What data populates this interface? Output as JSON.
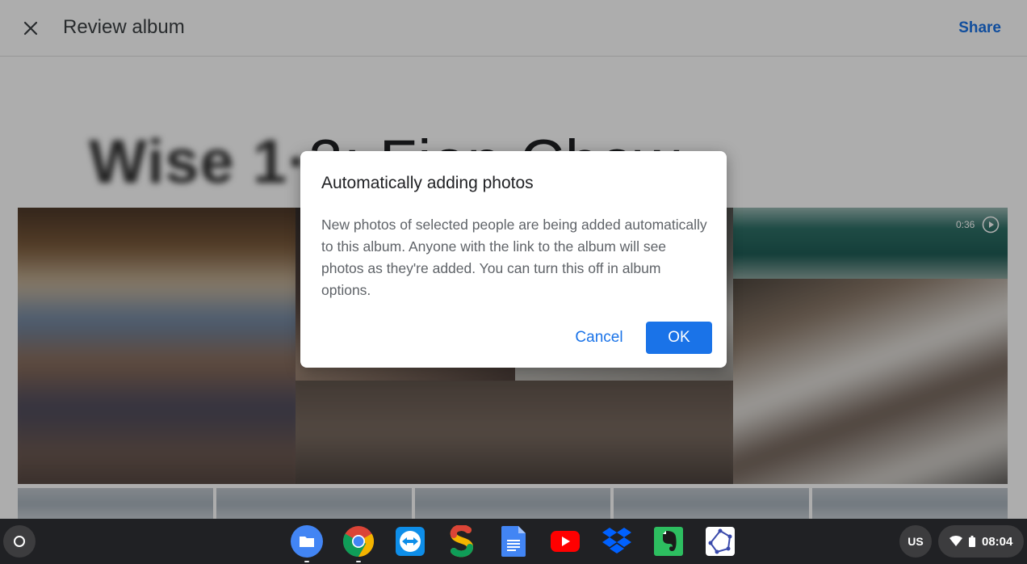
{
  "header": {
    "title": "Review album",
    "share_label": "Share"
  },
  "album": {
    "title_blurred": "Wise 1·",
    "title_clear": "3: Fion Chow",
    "video_duration": "0:36"
  },
  "dialog": {
    "title": "Automatically adding photos",
    "body": "New photos of selected people are being added automatically to this album. Anyone with the link to the album will see photos as they're added. You can turn this off in album options.",
    "cancel_label": "Cancel",
    "ok_label": "OK"
  },
  "shelf": {
    "apps": [
      {
        "name": "files-app-icon"
      },
      {
        "name": "chrome-app-icon"
      },
      {
        "name": "teamviewer-app-icon"
      },
      {
        "name": "sketchbook-app-icon"
      },
      {
        "name": "google-docs-app-icon"
      },
      {
        "name": "youtube-app-icon"
      },
      {
        "name": "dropbox-app-icon"
      },
      {
        "name": "evernote-app-icon"
      },
      {
        "name": "polygon-app-icon"
      }
    ],
    "ime_label": "US",
    "clock": "08:04"
  },
  "colors": {
    "accent": "#1a73e8",
    "shelf_bg": "#202124",
    "scrim": "rgba(0,0,0,0.32)"
  }
}
